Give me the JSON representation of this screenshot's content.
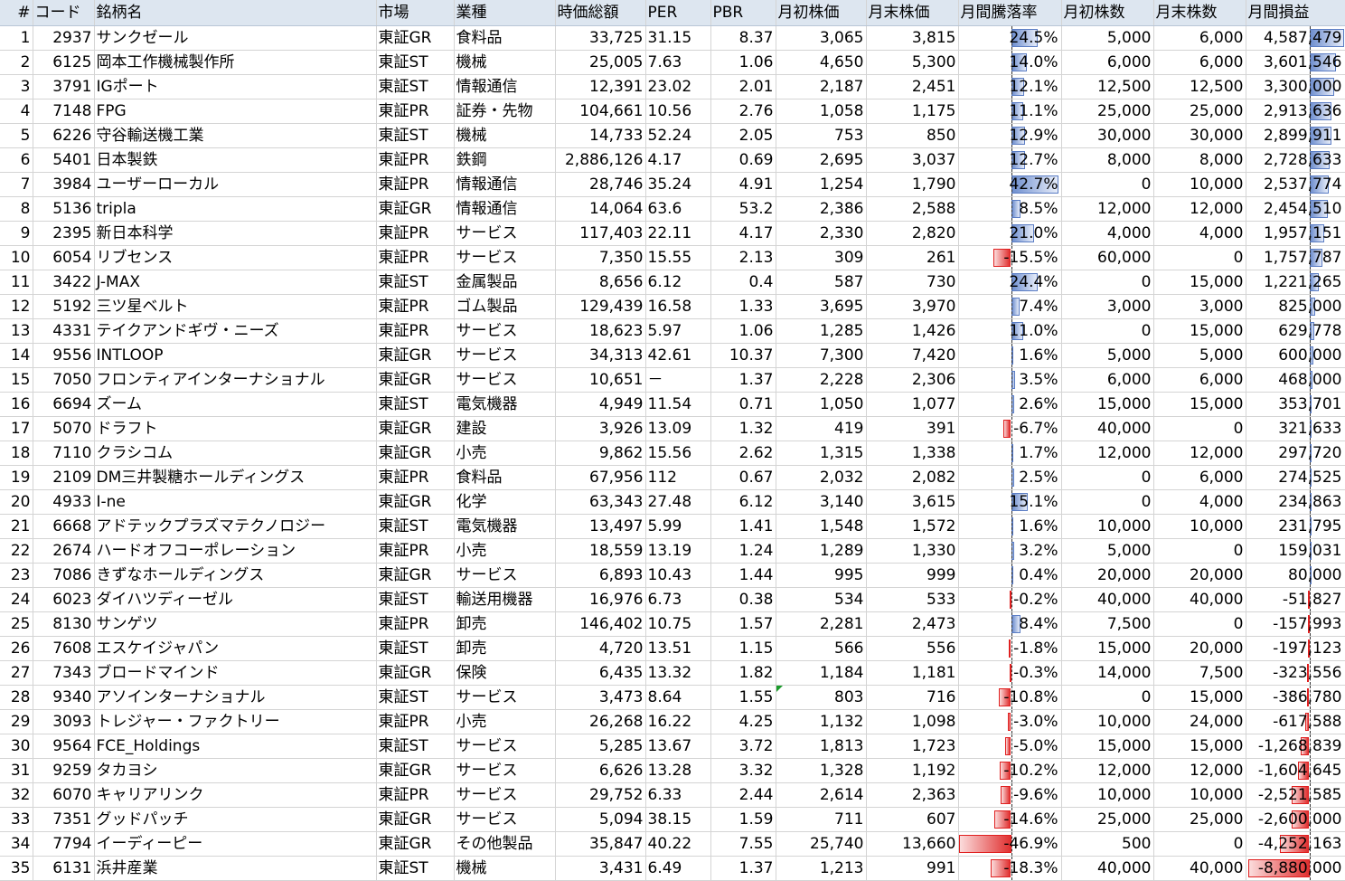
{
  "headers": [
    "#",
    "コード",
    "銘柄名",
    "市場",
    "業種",
    "時価総額",
    "PER",
    "PBR",
    "月初株価",
    "月末株価",
    "月間騰落率",
    "月初株数",
    "月末株数",
    "月間損益"
  ],
  "rows": [
    {
      "no": "1",
      "code": "2937",
      "name": "サンクゼール",
      "market": "東証GR",
      "sector": "食料品",
      "mcap": "33,725",
      "per": "31.15",
      "pbr": "8.37",
      "p_start": "3,065",
      "p_end": "3,815",
      "change": "24.5%",
      "change_value": 24.5,
      "sh_start": "5,000",
      "sh_end": "6,000",
      "pl": "4,587,479",
      "pl_value": 4587479
    },
    {
      "no": "2",
      "code": "6125",
      "name": "岡本工作機械製作所",
      "market": "東証ST",
      "sector": "機械",
      "mcap": "25,005",
      "per": "7.63",
      "pbr": "1.06",
      "p_start": "4,650",
      "p_end": "5,300",
      "change": "14.0%",
      "change_value": 14.0,
      "sh_start": "6,000",
      "sh_end": "6,000",
      "pl": "3,601,546",
      "pl_value": 3601546
    },
    {
      "no": "3",
      "code": "3791",
      "name": "IGポート",
      "market": "東証ST",
      "sector": "情報通信",
      "mcap": "12,391",
      "per": "23.02",
      "pbr": "2.01",
      "p_start": "2,187",
      "p_end": "2,451",
      "change": "12.1%",
      "change_value": 12.1,
      "sh_start": "12,500",
      "sh_end": "12,500",
      "pl": "3,300,000",
      "pl_value": 3300000
    },
    {
      "no": "4",
      "code": "7148",
      "name": "FPG",
      "market": "東証PR",
      "sector": "証券・先物",
      "mcap": "104,661",
      "per": "10.56",
      "pbr": "2.76",
      "p_start": "1,058",
      "p_end": "1,175",
      "change": "11.1%",
      "change_value": 11.1,
      "sh_start": "25,000",
      "sh_end": "25,000",
      "pl": "2,913,636",
      "pl_value": 2913636
    },
    {
      "no": "5",
      "code": "6226",
      "name": "守谷輸送機工業",
      "market": "東証ST",
      "sector": "機械",
      "mcap": "14,733",
      "per": "52.24",
      "pbr": "2.05",
      "p_start": "753",
      "p_end": "850",
      "change": "12.9%",
      "change_value": 12.9,
      "sh_start": "30,000",
      "sh_end": "30,000",
      "pl": "2,899,911",
      "pl_value": 2899911
    },
    {
      "no": "6",
      "code": "5401",
      "name": "日本製鉄",
      "market": "東証PR",
      "sector": "鉄鋼",
      "mcap": "2,886,126",
      "per": "4.17",
      "pbr": "0.69",
      "p_start": "2,695",
      "p_end": "3,037",
      "change": "12.7%",
      "change_value": 12.7,
      "sh_start": "8,000",
      "sh_end": "8,000",
      "pl": "2,728,633",
      "pl_value": 2728633
    },
    {
      "no": "7",
      "code": "3984",
      "name": "ユーザーローカル",
      "market": "東証PR",
      "sector": "情報通信",
      "mcap": "28,746",
      "per": "35.24",
      "pbr": "4.91",
      "p_start": "1,254",
      "p_end": "1,790",
      "change": "42.7%",
      "change_value": 42.7,
      "sh_start": "0",
      "sh_end": "10,000",
      "pl": "2,537,774",
      "pl_value": 2537774
    },
    {
      "no": "8",
      "code": "5136",
      "name": "tripla",
      "market": "東証GR",
      "sector": "情報通信",
      "mcap": "14,064",
      "per": "63.6",
      "pbr": "53.2",
      "p_start": "2,386",
      "p_end": "2,588",
      "change": "8.5%",
      "change_value": 8.5,
      "sh_start": "12,000",
      "sh_end": "12,000",
      "pl": "2,454,510",
      "pl_value": 2454510
    },
    {
      "no": "9",
      "code": "2395",
      "name": "新日本科学",
      "market": "東証PR",
      "sector": "サービス",
      "mcap": "117,403",
      "per": "22.11",
      "pbr": "4.17",
      "p_start": "2,330",
      "p_end": "2,820",
      "change": "21.0%",
      "change_value": 21.0,
      "sh_start": "4,000",
      "sh_end": "4,000",
      "pl": "1,957,151",
      "pl_value": 1957151
    },
    {
      "no": "10",
      "code": "6054",
      "name": "リブセンス",
      "market": "東証PR",
      "sector": "サービス",
      "mcap": "7,350",
      "per": "15.55",
      "pbr": "2.13",
      "p_start": "309",
      "p_end": "261",
      "change": "-15.5%",
      "change_value": -15.5,
      "sh_start": "60,000",
      "sh_end": "0",
      "pl": "1,757,787",
      "pl_value": 1757787
    },
    {
      "no": "11",
      "code": "3422",
      "name": "J-MAX",
      "market": "東証ST",
      "sector": "金属製品",
      "mcap": "8,656",
      "per": "6.12",
      "pbr": "0.4",
      "p_start": "587",
      "p_end": "730",
      "change": "24.4%",
      "change_value": 24.4,
      "sh_start": "0",
      "sh_end": "15,000",
      "pl": "1,221,265",
      "pl_value": 1221265
    },
    {
      "no": "12",
      "code": "5192",
      "name": "三ツ星ベルト",
      "market": "東証PR",
      "sector": "ゴム製品",
      "mcap": "129,439",
      "per": "16.58",
      "pbr": "1.33",
      "p_start": "3,695",
      "p_end": "3,970",
      "change": "7.4%",
      "change_value": 7.4,
      "sh_start": "3,000",
      "sh_end": "3,000",
      "pl": "825,000",
      "pl_value": 825000
    },
    {
      "no": "13",
      "code": "4331",
      "name": "テイクアンドギヴ・ニーズ",
      "market": "東証PR",
      "sector": "サービス",
      "mcap": "18,623",
      "per": "5.97",
      "pbr": "1.06",
      "p_start": "1,285",
      "p_end": "1,426",
      "change": "11.0%",
      "change_value": 11.0,
      "sh_start": "0",
      "sh_end": "15,000",
      "pl": "629,778",
      "pl_value": 629778
    },
    {
      "no": "14",
      "code": "9556",
      "name": "INTLOOP",
      "market": "東証GR",
      "sector": "サービス",
      "mcap": "34,313",
      "per": "42.61",
      "pbr": "10.37",
      "p_start": "7,300",
      "p_end": "7,420",
      "change": "1.6%",
      "change_value": 1.6,
      "sh_start": "5,000",
      "sh_end": "5,000",
      "pl": "600,000",
      "pl_value": 600000
    },
    {
      "no": "15",
      "code": "7050",
      "name": "フロンティアインターナショナル",
      "market": "東証GR",
      "sector": "サービス",
      "mcap": "10,651",
      "per": "－",
      "pbr": "1.37",
      "p_start": "2,228",
      "p_end": "2,306",
      "change": "3.5%",
      "change_value": 3.5,
      "sh_start": "6,000",
      "sh_end": "6,000",
      "pl": "468,000",
      "pl_value": 468000
    },
    {
      "no": "16",
      "code": "6694",
      "name": "ズーム",
      "market": "東証ST",
      "sector": "電気機器",
      "mcap": "4,949",
      "per": "11.54",
      "pbr": "0.71",
      "p_start": "1,050",
      "p_end": "1,077",
      "change": "2.6%",
      "change_value": 2.6,
      "sh_start": "15,000",
      "sh_end": "15,000",
      "pl": "353,701",
      "pl_value": 353701
    },
    {
      "no": "17",
      "code": "5070",
      "name": "ドラフト",
      "market": "東証GR",
      "sector": "建設",
      "mcap": "3,926",
      "per": "13.09",
      "pbr": "1.32",
      "p_start": "419",
      "p_end": "391",
      "change": "-6.7%",
      "change_value": -6.7,
      "sh_start": "40,000",
      "sh_end": "0",
      "pl": "321,633",
      "pl_value": 321633
    },
    {
      "no": "18",
      "code": "7110",
      "name": "クラシコム",
      "market": "東証GR",
      "sector": "小売",
      "mcap": "9,862",
      "per": "15.56",
      "pbr": "2.62",
      "p_start": "1,315",
      "p_end": "1,338",
      "change": "1.7%",
      "change_value": 1.7,
      "sh_start": "12,000",
      "sh_end": "12,000",
      "pl": "297,720",
      "pl_value": 297720
    },
    {
      "no": "19",
      "code": "2109",
      "name": "DM三井製糖ホールディングス",
      "market": "東証PR",
      "sector": "食料品",
      "mcap": "67,956",
      "per": "112",
      "pbr": "0.67",
      "p_start": "2,032",
      "p_end": "2,082",
      "change": "2.5%",
      "change_value": 2.5,
      "sh_start": "0",
      "sh_end": "6,000",
      "pl": "274,525",
      "pl_value": 274525
    },
    {
      "no": "20",
      "code": "4933",
      "name": "I-ne",
      "market": "東証GR",
      "sector": "化学",
      "mcap": "63,343",
      "per": "27.48",
      "pbr": "6.12",
      "p_start": "3,140",
      "p_end": "3,615",
      "change": "15.1%",
      "change_value": 15.1,
      "sh_start": "0",
      "sh_end": "4,000",
      "pl": "234,863",
      "pl_value": 234863
    },
    {
      "no": "21",
      "code": "6668",
      "name": "アドテックプラズマテクノロジー",
      "market": "東証ST",
      "sector": "電気機器",
      "mcap": "13,497",
      "per": "5.99",
      "pbr": "1.41",
      "p_start": "1,548",
      "p_end": "1,572",
      "change": "1.6%",
      "change_value": 1.6,
      "sh_start": "10,000",
      "sh_end": "10,000",
      "pl": "231,795",
      "pl_value": 231795
    },
    {
      "no": "22",
      "code": "2674",
      "name": "ハードオフコーポレーション",
      "market": "東証PR",
      "sector": "小売",
      "mcap": "18,559",
      "per": "13.19",
      "pbr": "1.24",
      "p_start": "1,289",
      "p_end": "1,330",
      "change": "3.2%",
      "change_value": 3.2,
      "sh_start": "5,000",
      "sh_end": "0",
      "pl": "159,031",
      "pl_value": 159031
    },
    {
      "no": "23",
      "code": "7086",
      "name": "きずなホールディングス",
      "market": "東証GR",
      "sector": "サービス",
      "mcap": "6,893",
      "per": "10.43",
      "pbr": "1.44",
      "p_start": "995",
      "p_end": "999",
      "change": "0.4%",
      "change_value": 0.4,
      "sh_start": "20,000",
      "sh_end": "20,000",
      "pl": "80,000",
      "pl_value": 80000
    },
    {
      "no": "24",
      "code": "6023",
      "name": "ダイハツディーゼル",
      "market": "東証ST",
      "sector": "輸送用機器",
      "mcap": "16,976",
      "per": "6.73",
      "pbr": "0.38",
      "p_start": "534",
      "p_end": "533",
      "change": "-0.2%",
      "change_value": -0.2,
      "sh_start": "40,000",
      "sh_end": "40,000",
      "pl": "-51,827",
      "pl_value": -51827
    },
    {
      "no": "25",
      "code": "8130",
      "name": "サンゲツ",
      "market": "東証PR",
      "sector": "卸売",
      "mcap": "146,402",
      "per": "10.75",
      "pbr": "1.57",
      "p_start": "2,281",
      "p_end": "2,473",
      "change": "8.4%",
      "change_value": 8.4,
      "sh_start": "7,500",
      "sh_end": "0",
      "pl": "-157,993",
      "pl_value": -157993
    },
    {
      "no": "26",
      "code": "7608",
      "name": "エスケイジャパン",
      "market": "東証ST",
      "sector": "卸売",
      "mcap": "4,720",
      "per": "13.51",
      "pbr": "1.15",
      "p_start": "566",
      "p_end": "556",
      "change": "-1.8%",
      "change_value": -1.8,
      "sh_start": "15,000",
      "sh_end": "20,000",
      "pl": "-197,123",
      "pl_value": -197123
    },
    {
      "no": "27",
      "code": "7343",
      "name": "ブロードマインド",
      "market": "東証GR",
      "sector": "保険",
      "mcap": "6,435",
      "per": "13.32",
      "pbr": "1.82",
      "p_start": "1,184",
      "p_end": "1,181",
      "change": "-0.3%",
      "change_value": -0.3,
      "sh_start": "14,000",
      "sh_end": "7,500",
      "pl": "-323,556",
      "pl_value": -323556
    },
    {
      "no": "28",
      "code": "9340",
      "name": "アソインターナショナル",
      "market": "東証ST",
      "sector": "サービス",
      "mcap": "3,473",
      "per": "8.64",
      "pbr": "1.55",
      "p_start": "803",
      "p_end": "716",
      "change": "-10.8%",
      "change_value": -10.8,
      "sh_start": "0",
      "sh_end": "15,000",
      "pl": "-386,780",
      "pl_value": -386780
    },
    {
      "no": "29",
      "code": "3093",
      "name": "トレジャー・ファクトリー",
      "market": "東証PR",
      "sector": "小売",
      "mcap": "26,268",
      "per": "16.22",
      "pbr": "4.25",
      "p_start": "1,132",
      "p_end": "1,098",
      "change": "-3.0%",
      "change_value": -3.0,
      "sh_start": "10,000",
      "sh_end": "24,000",
      "pl": "-617,588",
      "pl_value": -617588
    },
    {
      "no": "30",
      "code": "9564",
      "name": "FCE_Holdings",
      "market": "東証ST",
      "sector": "サービス",
      "mcap": "5,285",
      "per": "13.67",
      "pbr": "3.72",
      "p_start": "1,813",
      "p_end": "1,723",
      "change": "-5.0%",
      "change_value": -5.0,
      "sh_start": "15,000",
      "sh_end": "15,000",
      "pl": "-1,268,839",
      "pl_value": -1268839
    },
    {
      "no": "31",
      "code": "9259",
      "name": "タカヨシ",
      "market": "東証GR",
      "sector": "サービス",
      "mcap": "6,626",
      "per": "13.28",
      "pbr": "3.32",
      "p_start": "1,328",
      "p_end": "1,192",
      "change": "-10.2%",
      "change_value": -10.2,
      "sh_start": "12,000",
      "sh_end": "12,000",
      "pl": "-1,604,645",
      "pl_value": -1604645
    },
    {
      "no": "32",
      "code": "6070",
      "name": "キャリアリンク",
      "market": "東証PR",
      "sector": "サービス",
      "mcap": "29,752",
      "per": "6.33",
      "pbr": "2.44",
      "p_start": "2,614",
      "p_end": "2,363",
      "change": "-9.6%",
      "change_value": -9.6,
      "sh_start": "10,000",
      "sh_end": "10,000",
      "pl": "-2,521,585",
      "pl_value": -2521585
    },
    {
      "no": "33",
      "code": "7351",
      "name": "グッドパッチ",
      "market": "東証GR",
      "sector": "サービス",
      "mcap": "5,094",
      "per": "38.15",
      "pbr": "1.59",
      "p_start": "711",
      "p_end": "607",
      "change": "-14.6%",
      "change_value": -14.6,
      "sh_start": "25,000",
      "sh_end": "25,000",
      "pl": "-2,600,000",
      "pl_value": -2600000
    },
    {
      "no": "34",
      "code": "7794",
      "name": "イーディーピー",
      "market": "東証GR",
      "sector": "その他製品",
      "mcap": "35,847",
      "per": "40.22",
      "pbr": "7.55",
      "p_start": "25,740",
      "p_end": "13,660",
      "change": "-46.9%",
      "change_value": -46.9,
      "sh_start": "500",
      "sh_end": "0",
      "pl": "-4,252,163",
      "pl_value": -4252163
    },
    {
      "no": "35",
      "code": "6131",
      "name": "浜井産業",
      "market": "東証ST",
      "sector": "機械",
      "mcap": "3,431",
      "per": "6.49",
      "pbr": "1.37",
      "p_start": "1,213",
      "p_end": "991",
      "change": "-18.3%",
      "change_value": -18.3,
      "sh_start": "40,000",
      "sh_end": "40,000",
      "pl": "-8,880,000",
      "pl_value": -8880000
    }
  ],
  "colors": {
    "positive_bar": "#6f8fcf",
    "negative_bar": "#e03030",
    "header_bg": "#dde6f0",
    "grid": "#d4d4d4"
  }
}
